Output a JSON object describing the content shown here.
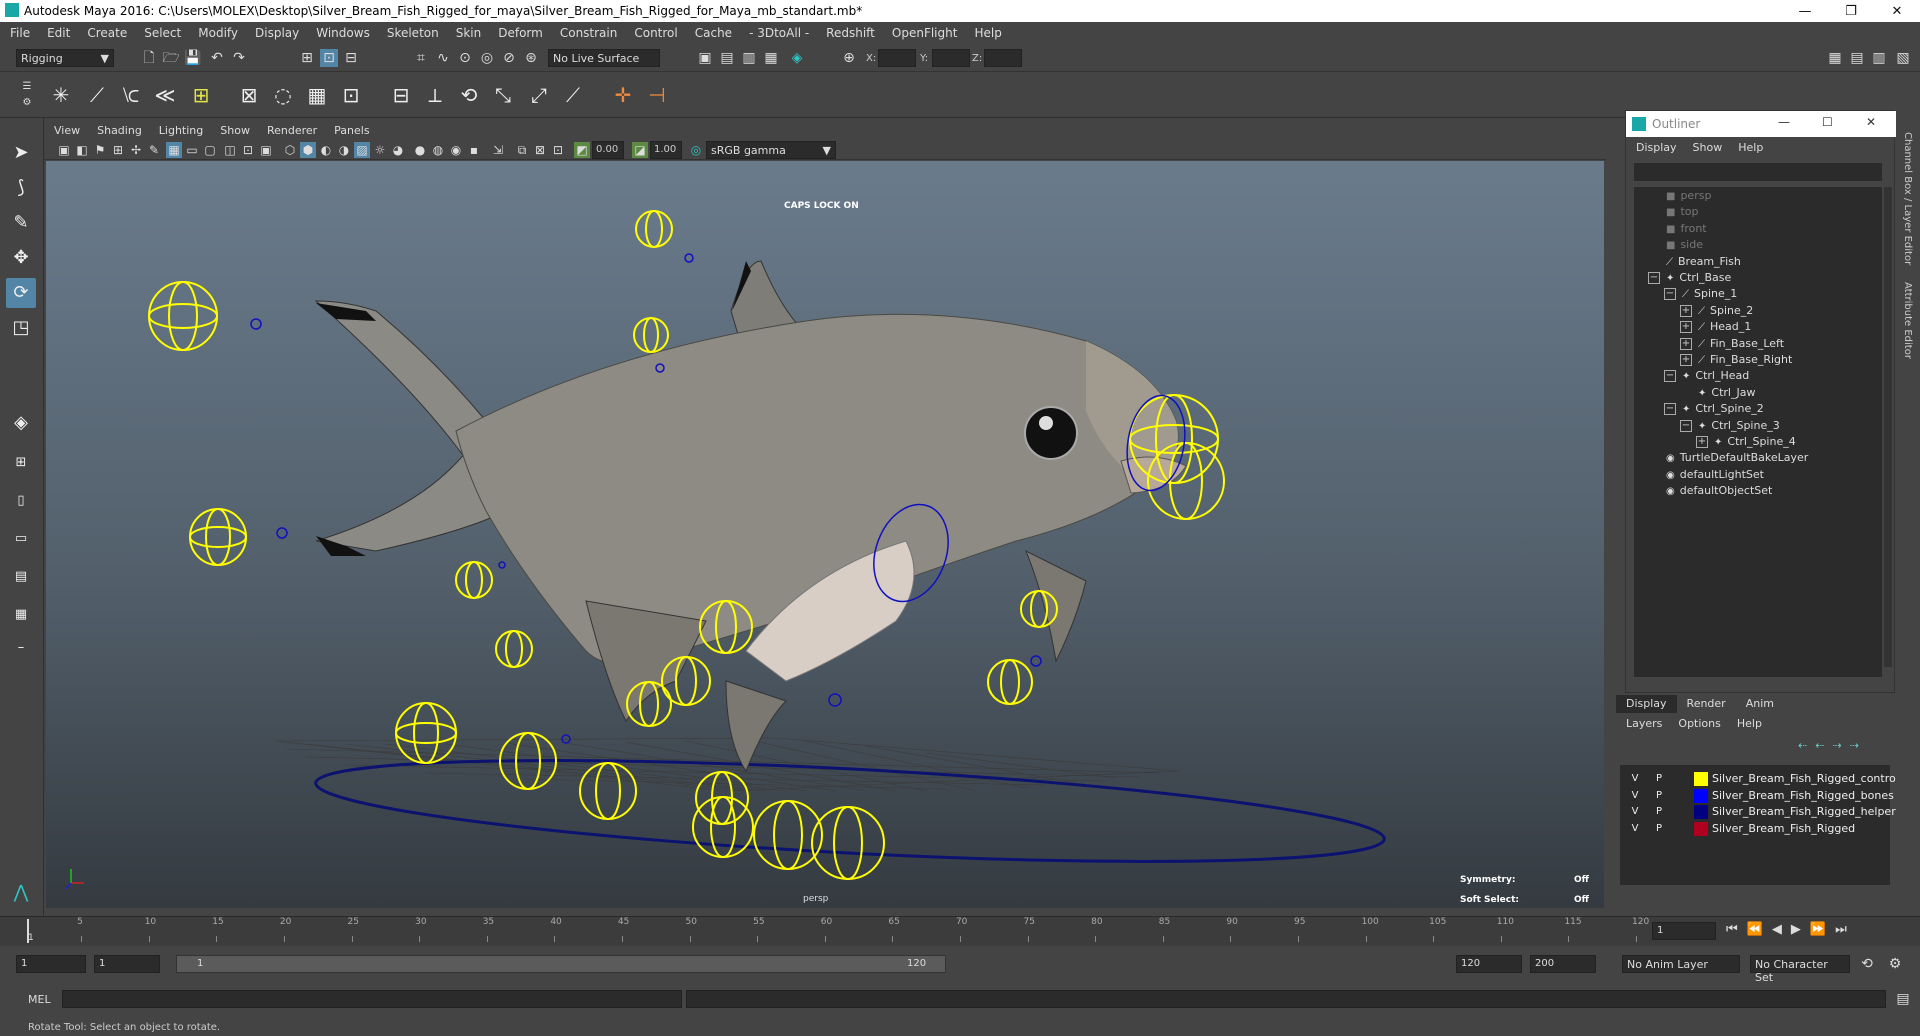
{
  "window": {
    "title": "Autodesk Maya 2016: C:\\Users\\MOLEX\\Desktop\\Silver_Bream_Fish_Rigged_for_maya\\Silver_Bream_Fish_Rigged_for_Maya_mb_standart.mb*",
    "minimize": "—",
    "maximize": "❐",
    "close": "✕"
  },
  "menu": [
    "File",
    "Edit",
    "Create",
    "Select",
    "Modify",
    "Display",
    "Windows",
    "Skeleton",
    "Skin",
    "Deform",
    "Constrain",
    "Control",
    "Cache",
    "- 3DtoAll -",
    "Redshift",
    "OpenFlight",
    "Help"
  ],
  "status": {
    "menuset": "Rigging",
    "live_surface": "No Live Surface",
    "x_label": "X:",
    "y_label": "Y:",
    "z_label": "Z:"
  },
  "panel_menu": [
    "View",
    "Shading",
    "Lighting",
    "Show",
    "Renderer",
    "Panels"
  ],
  "panel_tools": {
    "exposure": "0.00",
    "gamma": "1.00",
    "colorspace": "sRGB gamma"
  },
  "viewport": {
    "caps_lock": "CAPS LOCK ON",
    "camera": "persp",
    "symmetry_label": "Symmetry:",
    "symmetry_value": "Off",
    "soft_select_label": "Soft Select:",
    "soft_select_value": "Off"
  },
  "timeline": {
    "ticks": [
      "5",
      "10",
      "15",
      "20",
      "25",
      "30",
      "35",
      "40",
      "45",
      "50",
      "55",
      "60",
      "65",
      "70",
      "75",
      "80",
      "85",
      "90",
      "95",
      "100",
      "105",
      "110",
      "115",
      "120"
    ],
    "start_tick": "1",
    "current_frame": "1"
  },
  "range": {
    "start": "1",
    "playback_start": "1",
    "slider_start": "1",
    "slider_end": "120",
    "playback_end": "120",
    "end": "200",
    "anim_layer": "No Anim Layer",
    "char_set": "No Character Set"
  },
  "cmd": {
    "label": "MEL"
  },
  "help_line": "Rotate Tool: Select an object to rotate.",
  "outliner": {
    "title": "Outliner",
    "menu": [
      "Display",
      "Show",
      "Help"
    ],
    "items": [
      {
        "label": "persp",
        "indent": 0,
        "gray": true,
        "exp": ""
      },
      {
        "label": "top",
        "indent": 0,
        "gray": true,
        "exp": ""
      },
      {
        "label": "front",
        "indent": 0,
        "gray": true,
        "exp": ""
      },
      {
        "label": "side",
        "indent": 0,
        "gray": true,
        "exp": ""
      },
      {
        "label": "Bream_Fish",
        "indent": 0,
        "gray": false,
        "exp": ""
      },
      {
        "label": "Ctrl_Base",
        "indent": 0,
        "gray": false,
        "exp": "−"
      },
      {
        "label": "Spine_1",
        "indent": 1,
        "gray": false,
        "exp": "−"
      },
      {
        "label": "Spine_2",
        "indent": 2,
        "gray": false,
        "exp": "+"
      },
      {
        "label": "Head_1",
        "indent": 2,
        "gray": false,
        "exp": "+"
      },
      {
        "label": "Fin_Base_Left",
        "indent": 2,
        "gray": false,
        "exp": "+"
      },
      {
        "label": "Fin_Base_Right",
        "indent": 2,
        "gray": false,
        "exp": "+"
      },
      {
        "label": "Ctrl_Head",
        "indent": 1,
        "gray": false,
        "exp": "−"
      },
      {
        "label": "Ctrl_Jaw",
        "indent": 2,
        "gray": false,
        "exp": ""
      },
      {
        "label": "Ctrl_Spine_2",
        "indent": 1,
        "gray": false,
        "exp": "−"
      },
      {
        "label": "Ctrl_Spine_3",
        "indent": 2,
        "gray": false,
        "exp": "−"
      },
      {
        "label": "Ctrl_Spine_4",
        "indent": 3,
        "gray": false,
        "exp": "+"
      },
      {
        "label": "TurtleDefaultBakeLayer",
        "indent": 0,
        "gray": false,
        "exp": ""
      },
      {
        "label": "defaultLightSet",
        "indent": 0,
        "gray": false,
        "exp": ""
      },
      {
        "label": "defaultObjectSet",
        "indent": 0,
        "gray": false,
        "exp": ""
      }
    ]
  },
  "layers": {
    "tabs": [
      "Display",
      "Render",
      "Anim"
    ],
    "menu": [
      "Layers",
      "Options",
      "Help"
    ],
    "rows": [
      {
        "v": "V",
        "p": "P",
        "color": "#ffff00",
        "name": "Silver_Bream_Fish_Rigged_controlle"
      },
      {
        "v": "V",
        "p": "P",
        "color": "#0000ff",
        "name": "Silver_Bream_Fish_Rigged_bones"
      },
      {
        "v": "V",
        "p": "P",
        "color": "#000080",
        "name": "Silver_Bream_Fish_Rigged_helpers"
      },
      {
        "v": "V",
        "p": "P",
        "color": "#b00020",
        "name": "Silver_Bream_Fish_Rigged"
      }
    ]
  },
  "side": {
    "channel_box": "Channel Box / Layer Editor",
    "attr_editor": "Attribute Editor"
  }
}
